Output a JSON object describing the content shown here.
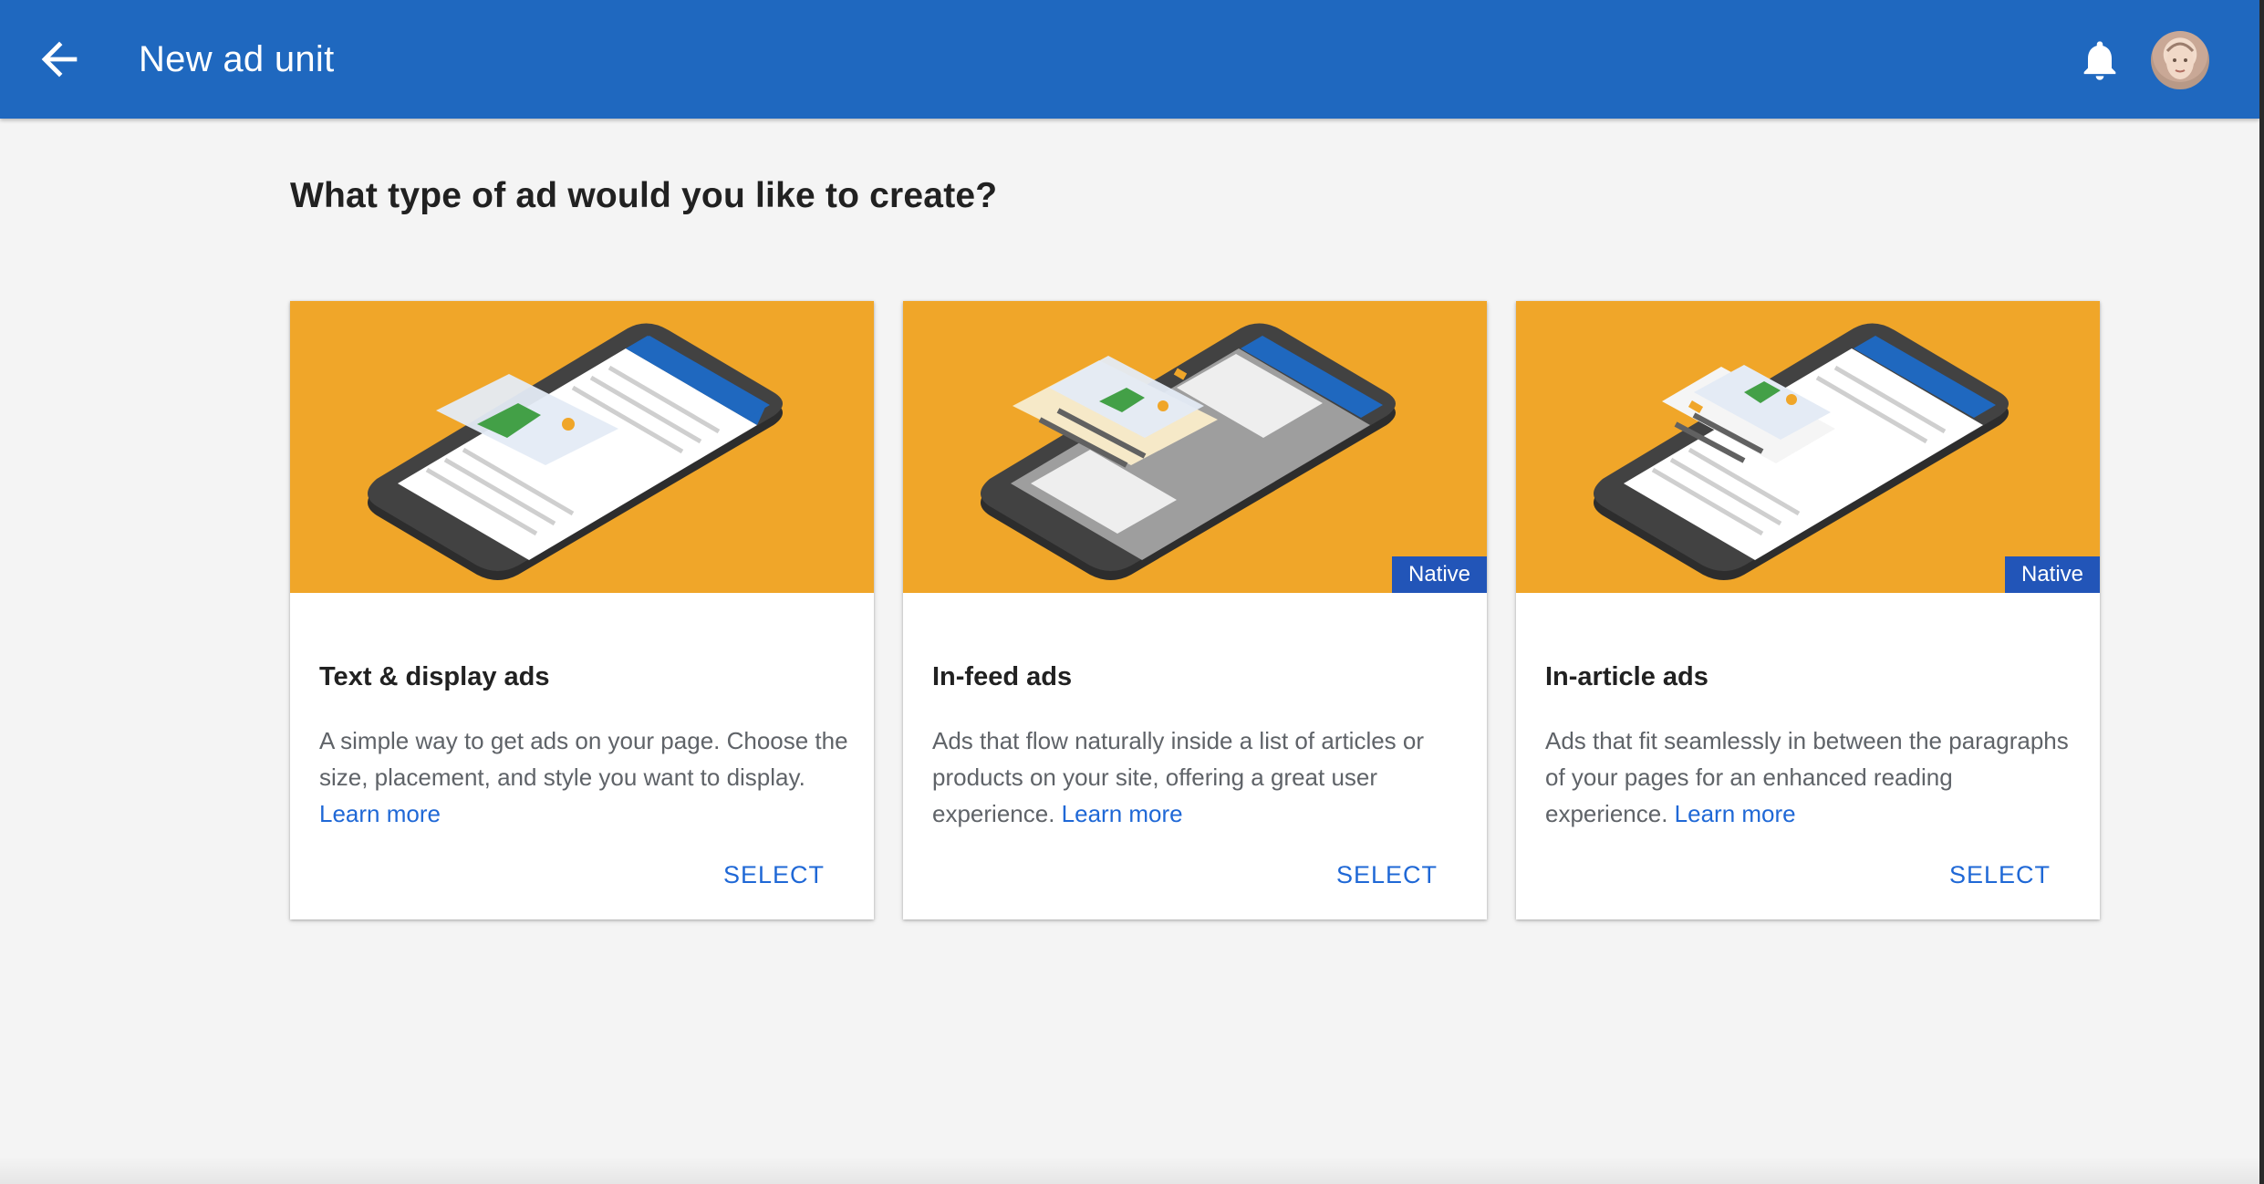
{
  "appbar": {
    "title": "New ad unit"
  },
  "page": {
    "heading": "What type of ad would you like to create?"
  },
  "cards": [
    {
      "title": "Text & display ads",
      "description": "A simple way to get ads on your page. Choose the size, placement, and style you want to display.",
      "learn_more": "Learn more",
      "select_label": "SELECT",
      "badge": ""
    },
    {
      "title": "In-feed ads",
      "description": "Ads that flow naturally inside a list of articles or products on your site, offering a great user experience.",
      "learn_more": "Learn more",
      "select_label": "SELECT",
      "badge": "Native"
    },
    {
      "title": "In-article ads",
      "description": "Ads that fit seamlessly in between the paragraphs of your pages for an enhanced reading experience.",
      "learn_more": "Learn more",
      "select_label": "SELECT",
      "badge": "Native"
    }
  ],
  "icons": {
    "back": "arrow-back-icon",
    "notifications": "bell-icon",
    "account": "avatar"
  },
  "colors": {
    "appbar": "#1f68bf",
    "banner": "#f0a629",
    "badge": "#2255b8",
    "link": "#1f68d6"
  }
}
